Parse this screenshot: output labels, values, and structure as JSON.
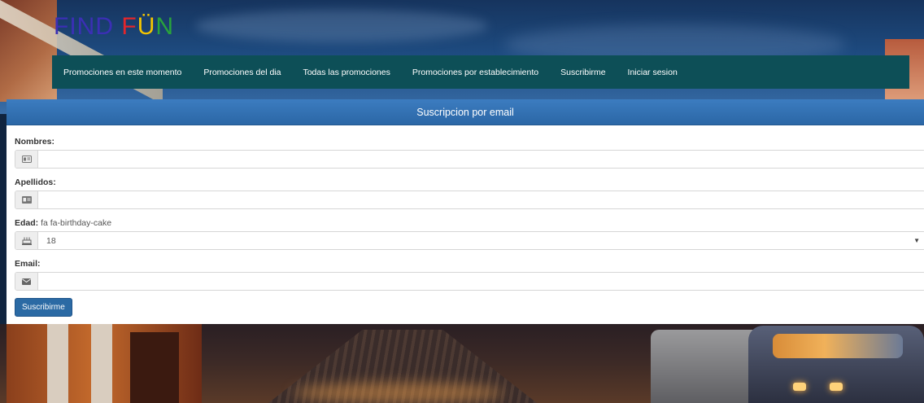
{
  "logo": {
    "letters": [
      {
        "char": "F",
        "color": "#3b2fb5"
      },
      {
        "char": "I",
        "color": "#3b2fb5"
      },
      {
        "char": "N",
        "color": "#3b2fb5"
      },
      {
        "char": "D",
        "color": "#3b2fb5"
      },
      {
        "char": " ",
        "color": "#ffffff"
      },
      {
        "char": "F",
        "color": "#e3262c"
      },
      {
        "char": "Ü",
        "color": "#f4c400"
      },
      {
        "char": "N",
        "color": "#29a33c"
      }
    ]
  },
  "nav": {
    "items": [
      {
        "label": "Promociones en este momento"
      },
      {
        "label": "Promociones del dia"
      },
      {
        "label": "Todas las promociones"
      },
      {
        "label": "Promociones por establecimiento"
      },
      {
        "label": "Suscribirme"
      },
      {
        "label": "Iniciar sesion"
      }
    ],
    "background": "#0d4f57"
  },
  "panel": {
    "heading": "Suscripcion por email",
    "heading_color": "#2f6fb2"
  },
  "form": {
    "nombres": {
      "label": "Nombres:",
      "value": "",
      "icon": "id-card-icon"
    },
    "apellidos": {
      "label": "Apellidos:",
      "value": "",
      "icon": "id-card-icon"
    },
    "edad": {
      "label": "Edad:",
      "label_extra": "fa fa-birthday-cake",
      "selected": "18",
      "icon": "birthday-cake-icon"
    },
    "email": {
      "label": "Email:",
      "value": "",
      "icon": "envelope-icon"
    },
    "submit_label": "Suscribirme"
  }
}
